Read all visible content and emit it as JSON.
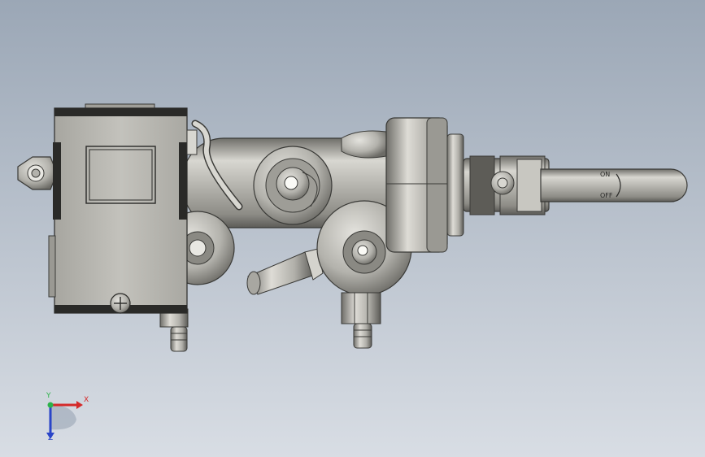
{
  "viewport": {
    "background_top": "#9ba7b6",
    "background_bottom": "#d8dde4"
  },
  "model": {
    "body_color": "#b9b8b2",
    "shadow_color": "#6f6e69",
    "dark_color": "#2a2a28",
    "handle_labels": {
      "on": "ON",
      "off": "OFF"
    }
  },
  "triad": {
    "x_label": "X",
    "y_label": "Y",
    "z_label": "Z",
    "x_color": "#d42a2a",
    "y_color": "#2db24a",
    "z_color": "#2a45c8"
  }
}
